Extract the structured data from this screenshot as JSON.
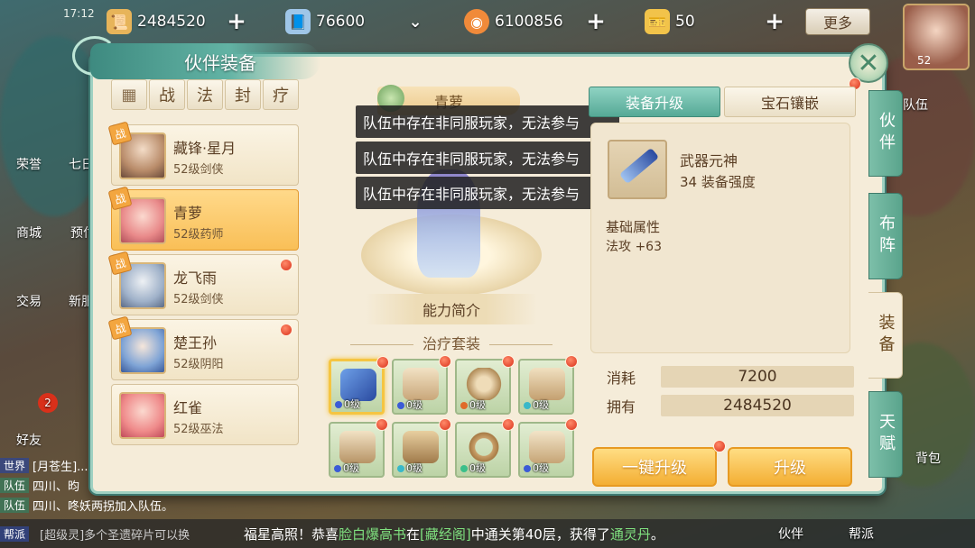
{
  "status": {
    "time": "17:12"
  },
  "resources": [
    {
      "name": "scroll-currency",
      "value": "2484520",
      "color": "#e7b45a"
    },
    {
      "name": "silver-scroll-currency",
      "value": "76600",
      "color": "#9fc6e8"
    },
    {
      "name": "coin-currency",
      "value": "6100856",
      "color": "#f08a3a"
    },
    {
      "name": "ticket-currency",
      "value": "50",
      "color": "#f2c34a"
    }
  ],
  "more_button": "更多",
  "top_avatar": {
    "level": "52"
  },
  "side_menu": {
    "honor": "荣誉",
    "seven_day": "七日",
    "mall": "商城",
    "prepay": "预付",
    "trade": "交易",
    "newbie": "新服",
    "friends": "好友",
    "friends_badge": "2",
    "team_right": "队伍",
    "leader_hint": "长"
  },
  "panel": {
    "title": "伙伴装备",
    "filters": [
      "战",
      "法",
      "封",
      "疗"
    ],
    "partners": [
      {
        "name": "藏锋·星月",
        "info": "52级剑侠",
        "battle": "战",
        "selected": false,
        "dot": false
      },
      {
        "name": "青萝",
        "info": "52级药师",
        "battle": "战",
        "selected": true,
        "dot": false
      },
      {
        "name": "龙飞雨",
        "info": "52级剑侠",
        "battle": "战",
        "selected": false,
        "dot": true
      },
      {
        "name": "楚王孙",
        "info": "52级阴阳",
        "battle": "战",
        "selected": false,
        "dot": true
      },
      {
        "name": "红雀",
        "info": "52级巫法",
        "battle": "",
        "selected": false,
        "dot": false
      }
    ],
    "character_name": "青萝",
    "ability_intro": "能力简介",
    "suit_title": "治疗套装",
    "equipment": [
      {
        "name": "sword",
        "level": "0级",
        "gem": "#3b5bd6"
      },
      {
        "name": "hat",
        "level": "0级",
        "gem": "#3b5bd6"
      },
      {
        "name": "necklace",
        "level": "0级",
        "gem": "#e06a2a"
      },
      {
        "name": "robe",
        "level": "0级",
        "gem": "#39b8c9"
      },
      {
        "name": "belt",
        "level": "0级",
        "gem": "#3b5bd6"
      },
      {
        "name": "bracer",
        "level": "0级",
        "gem": "#39b8c9"
      },
      {
        "name": "ring",
        "level": "0级",
        "gem": "#3bbf8a"
      },
      {
        "name": "shoes",
        "level": "0级",
        "gem": "#3b5bd6"
      }
    ],
    "tabs": {
      "upgrade": "装备升级",
      "gem": "宝石镶嵌"
    },
    "weapon": {
      "name": "武器元神",
      "power": "34 装备强度",
      "attr_title": "基础属性",
      "attr_value": "法攻 +63"
    },
    "cost": {
      "label": "消耗",
      "value": "7200"
    },
    "own": {
      "label": "拥有",
      "value": "2484520"
    },
    "buttons": {
      "one_click": "一键升级",
      "upgrade": "升级"
    },
    "side_tabs": [
      "伙伴",
      "布阵",
      "装备",
      "天赋"
    ]
  },
  "toasts": [
    "队伍中存在非同服玩家，无法参与",
    "队伍中存在非同服玩家，无法参与",
    "队伍中存在非同服玩家，无法参与"
  ],
  "chat": [
    {
      "channel": "世界",
      "text": "[月苍生]..."
    },
    {
      "channel": "队伍",
      "text": "四川、昀"
    },
    {
      "channel": "队伍",
      "text": "四川、咚妖两拐加入队伍。"
    },
    {
      "channel": "帮派",
      "text": "[超级灵]多个圣遗碎片可以换"
    }
  ],
  "marquee": {
    "prefix": "福星高照！恭喜",
    "player": "脸白爆高书",
    "mid": "在",
    "place": "[藏经阁]",
    "suffix": "中通关第40层，获得了",
    "reward": "通灵丹",
    "end": "。"
  },
  "bottom_nav": {
    "partner": "伙伴",
    "guild": "帮派",
    "bag": "背包"
  }
}
